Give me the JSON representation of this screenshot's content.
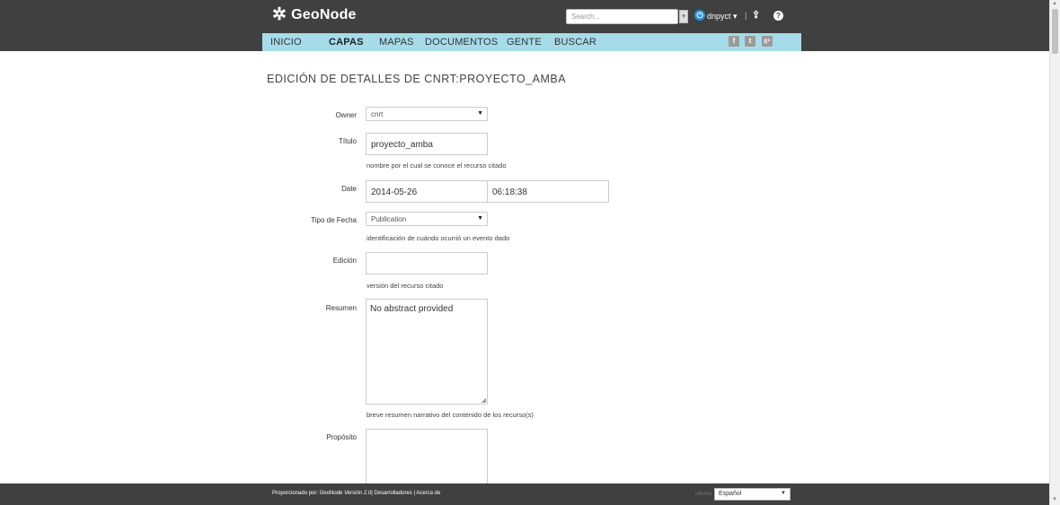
{
  "header": {
    "logo_text": "GeoNode",
    "logo_icon": "geonode-snowflake-icon",
    "search": {
      "placeholder": "Search..."
    },
    "user": {
      "name": "dnpyct",
      "caret": "▾"
    },
    "separator": "|"
  },
  "nav": {
    "items": [
      {
        "label": "INICIO",
        "active": false
      },
      {
        "label": "CAPAS",
        "active": true
      },
      {
        "label": "MAPAS",
        "active": false
      },
      {
        "label": "DOCUMENTOS",
        "active": false
      },
      {
        "label": "GENTE",
        "active": false
      },
      {
        "label": "BUSCAR",
        "active": false
      }
    ],
    "social": [
      {
        "name": "facebook-icon",
        "glyph": "f"
      },
      {
        "name": "twitter-icon",
        "glyph": "t"
      },
      {
        "name": "google-plus-icon",
        "glyph": "g+"
      }
    ],
    "accent_color": "#a6dcea"
  },
  "page": {
    "title": "EDICIÓN DE DETALLES DE CNRT:PROYECTO_AMBA"
  },
  "form": {
    "owner": {
      "label": "Owner",
      "value": "cnrt"
    },
    "titulo": {
      "label": "Título",
      "value": "proyecto_amba",
      "help": "nombre por el cual se conoce el recurso citado"
    },
    "date": {
      "label": "Date",
      "date_value": "2014-05-26",
      "time_value": "06:18:38"
    },
    "tipo_fecha": {
      "label": "Tipo de Fecha",
      "value": "Publication",
      "help": "identificación de cuándo ocurrió un evento dado"
    },
    "edicion": {
      "label": "Edición",
      "value": "",
      "help": "versión del recurso citado"
    },
    "resumen": {
      "label": "Resumen",
      "value": "No abstract provided",
      "help": "breve resumen narrativo del contenido de los recurso(s)"
    },
    "proposito": {
      "label": "Propósito",
      "value": ""
    }
  },
  "footer": {
    "powered_prefix": "Proporcionado por: GeoNode ",
    "version": "Versión 2.0",
    "links": "| Desarrolladores | Acerca de",
    "language_label": "Idioma",
    "language_value": "Español"
  },
  "colors": {
    "topbar": "#404040",
    "navbar": "#a6dcea",
    "user_icon": "#2a8fd6"
  }
}
